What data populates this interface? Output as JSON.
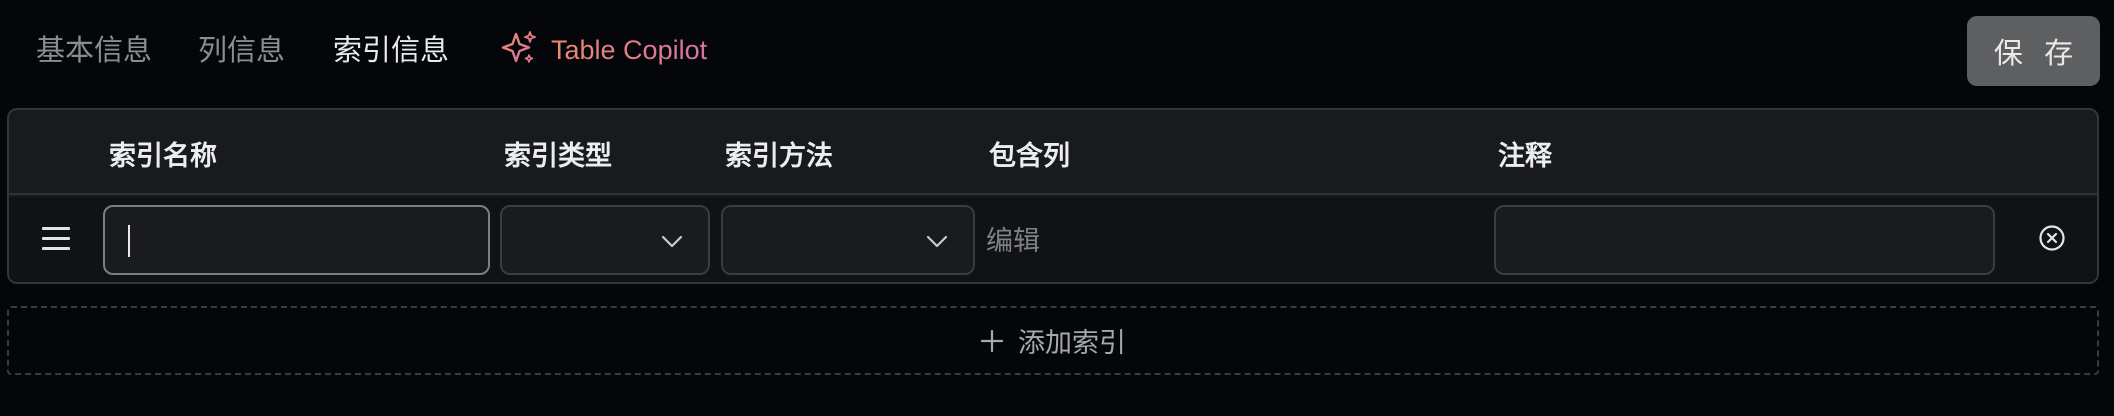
{
  "tabs": [
    {
      "label": "基本信息"
    },
    {
      "label": "列信息"
    },
    {
      "label": "索引信息"
    }
  ],
  "active_tab": "索引信息",
  "copilot": {
    "label": "Table Copilot",
    "icon": "sparkle-icon"
  },
  "save_button": {
    "label": "保 存"
  },
  "table": {
    "columns": [
      "索引名称",
      "索引类型",
      "索引方法",
      "包含列",
      "注释"
    ],
    "rows": [
      {
        "name": "",
        "type": "",
        "method": "",
        "columns_action": "编辑",
        "comment": ""
      }
    ]
  },
  "add_index": {
    "label": "添加索引",
    "icon": "plus-icon"
  },
  "colors": {
    "background": "#05060a",
    "panel": "#191a1d",
    "row": "#111215",
    "save_button": "#5e5f61",
    "copilot_gradient_start": "#ee8a6a",
    "copilot_gradient_end": "#d774a7"
  }
}
